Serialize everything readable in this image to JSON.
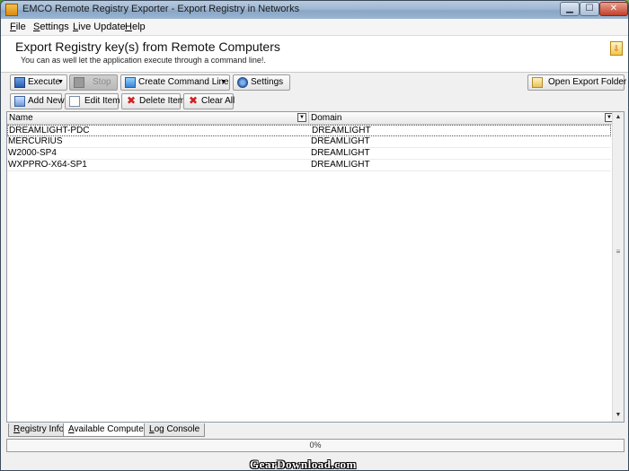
{
  "window": {
    "title": "EMCO Remote Registry Exporter - Export Registry in Networks",
    "min_glyph": "▁",
    "max_glyph": "☐",
    "close_glyph": "✕"
  },
  "menu": {
    "items": [
      {
        "acc": "F",
        "rest": "ile"
      },
      {
        "acc": "S",
        "rest": "ettings"
      },
      {
        "acc": "L",
        "rest": "ive Update"
      },
      {
        "acc": "H",
        "rest": "elp"
      }
    ]
  },
  "header": {
    "title": "Export Registry key(s) from Remote Computers",
    "subtitle": "You can as well let the application execute through a command line!.",
    "icon_glyph": "⇩"
  },
  "toolbar1": {
    "execute": "Execute",
    "stop": "Stop",
    "create_command_line": "Create Command Line",
    "settings": "Settings",
    "open_export_folder": "Open Export Folder",
    "dropdown_glyph": "▼"
  },
  "toolbar2": {
    "add_new": "Add New",
    "edit_item": "Edit Item",
    "delete_item": "Delete Item",
    "clear_all": "Clear All",
    "x_glyph": "✖"
  },
  "list": {
    "columns": {
      "name": "Name",
      "domain": "Domain"
    },
    "filter_glyph": "▼",
    "rows": [
      {
        "name": "DREAMLIGHT-PDC",
        "domain": "DREAMLIGHT"
      },
      {
        "name": "MERCURIUS",
        "domain": "DREAMLIGHT"
      },
      {
        "name": "W2000-SP4",
        "domain": "DREAMLIGHT"
      },
      {
        "name": "WXPPRO-X64-SP1",
        "domain": "DREAMLIGHT"
      }
    ],
    "scroll_up": "▲",
    "scroll_down": "▼",
    "scroll_thumb": "≡"
  },
  "tabs": [
    {
      "acc": "R",
      "rest": "egistry Info"
    },
    {
      "acc": "A",
      "rest": "vailable Computers"
    },
    {
      "acc": "L",
      "rest": "og Console"
    }
  ],
  "status": {
    "progress": "0%"
  },
  "watermark": "GearDownload.com"
}
